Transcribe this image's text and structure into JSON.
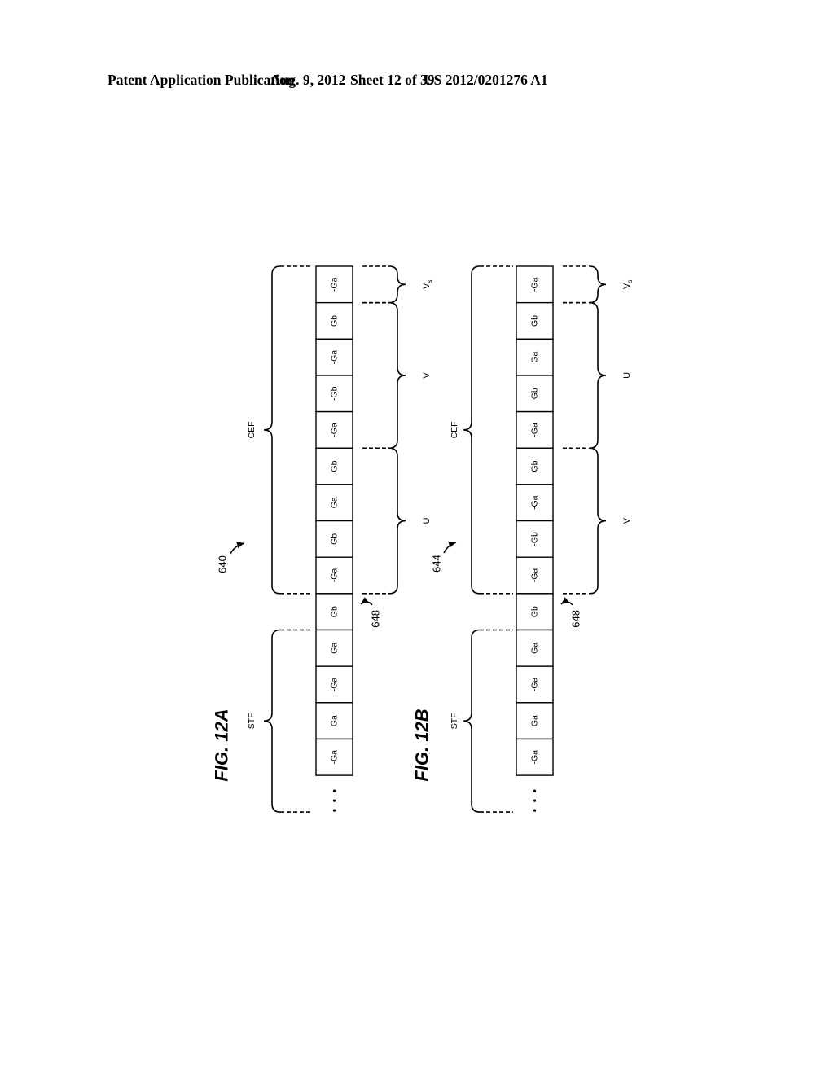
{
  "header": {
    "publication": "Patent Application Publication",
    "date": "Aug. 9, 2012",
    "sheet": "Sheet 12 of 39",
    "number": "US 2012/0201276 A1"
  },
  "figures": [
    {
      "id": "12A",
      "title": "FIG. 12A",
      "ref_numeral": "640",
      "boundary_ref": "648",
      "cells_top_to_bottom": [
        "-Ga",
        "Gb",
        "-Ga",
        "-Gb",
        "-Ga",
        "Gb",
        "Ga",
        "Gb",
        "-Ga",
        "Gb",
        "Ga",
        "-Ga",
        "Ga",
        "-Ga"
      ],
      "continuation": "...",
      "left_braces": [
        {
          "label": "CEF",
          "from_cell": 0,
          "to_cell": 8
        },
        {
          "label": "STF",
          "from_cell": 9,
          "to_cell": 13,
          "open_end": true
        }
      ],
      "right_braces": [
        {
          "label": "Vs",
          "from_cell": 0,
          "to_cell": 0
        },
        {
          "label": "V",
          "from_cell": 1,
          "to_cell": 4
        },
        {
          "label": "U",
          "from_cell": 5,
          "to_cell": 8
        }
      ]
    },
    {
      "id": "12B",
      "title": "FIG. 12B",
      "ref_numeral": "644",
      "boundary_ref": "648",
      "cells_top_to_bottom": [
        "-Ga",
        "Gb",
        "Ga",
        "Gb",
        "-Ga",
        "Gb",
        "-Ga",
        "-Gb",
        "-Ga",
        "Gb",
        "Ga",
        "-Ga",
        "Ga",
        "-Ga"
      ],
      "continuation": "...",
      "left_braces": [
        {
          "label": "CEF",
          "from_cell": 0,
          "to_cell": 8
        },
        {
          "label": "STF",
          "from_cell": 9,
          "to_cell": 13,
          "open_end": true
        }
      ],
      "right_braces": [
        {
          "label": "Vs",
          "from_cell": 0,
          "to_cell": 0
        },
        {
          "label": "U",
          "from_cell": 1,
          "to_cell": 4
        },
        {
          "label": "V",
          "from_cell": 5,
          "to_cell": 8
        }
      ]
    }
  ]
}
